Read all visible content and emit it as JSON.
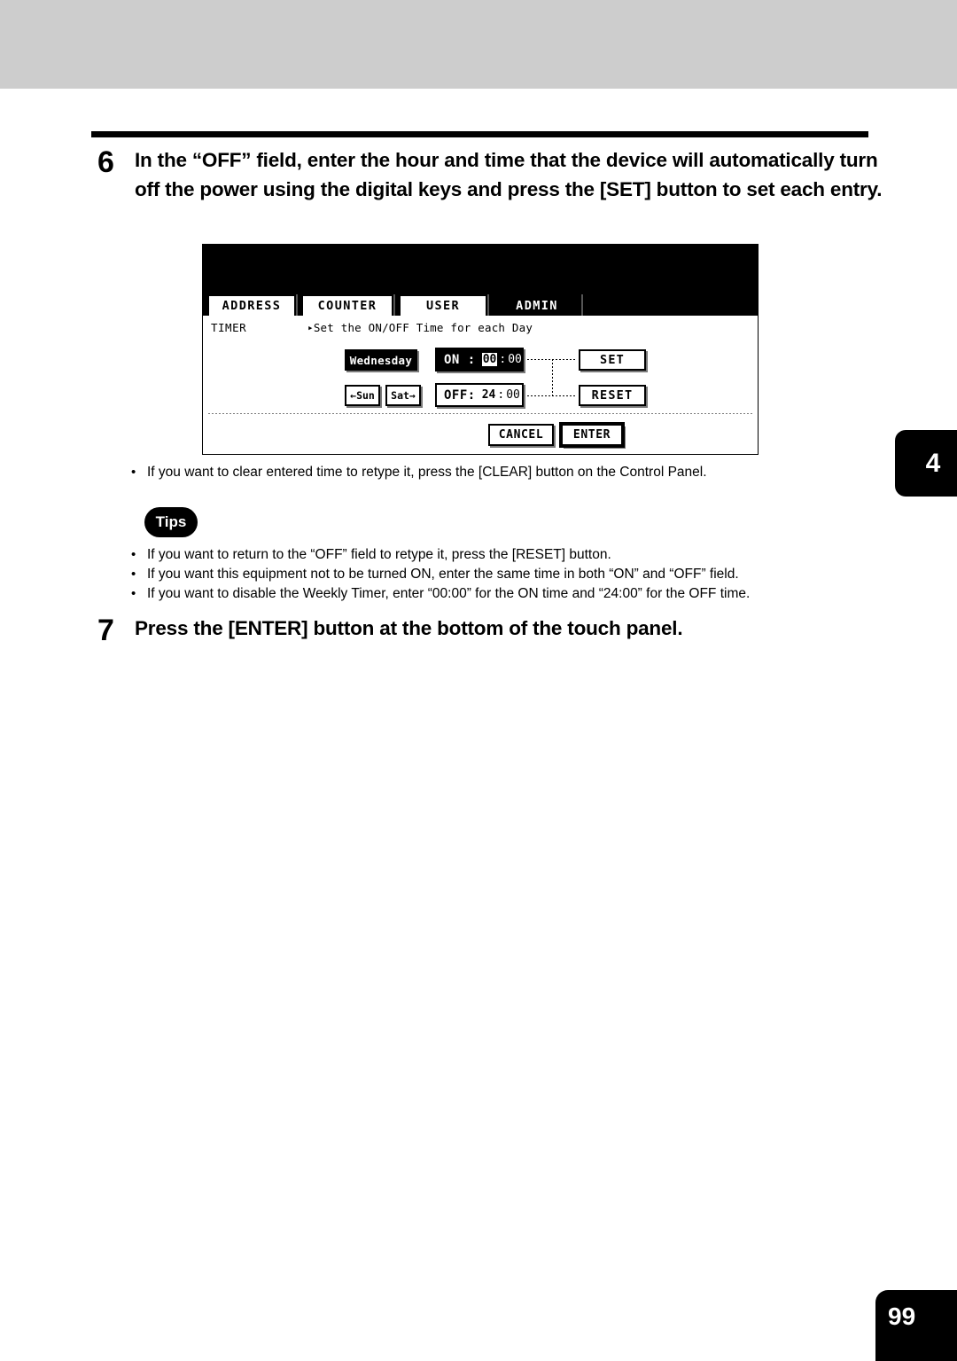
{
  "page": {
    "number": "99",
    "chapter_tab": "4"
  },
  "steps": [
    {
      "number": "6",
      "text": "In the “OFF” field, enter the hour and time that the device will automatically turn off the power using the digital keys and press the [SET] button to set each entry."
    },
    {
      "number": "7",
      "text": "Press the [ENTER] button at the bottom of the touch panel."
    }
  ],
  "notes": [
    {
      "bullet": "•",
      "text": "If you want to clear entered time to retype it, press the [CLEAR] button on the Control Panel."
    }
  ],
  "tips": {
    "badge": "Tips",
    "items": [
      {
        "bullet": "•",
        "text": "If you want to return to the “OFF” field to retype it, press the [RESET] button."
      },
      {
        "bullet": "•",
        "text": "If you want this equipment not to be turned ON, enter the same time in both “ON” and “OFF” field."
      },
      {
        "bullet": "•",
        "text": "If you want to disable the Weekly Timer, enter “00:00” for the ON time and “24:00” for the OFF time."
      }
    ]
  },
  "touch_panel": {
    "tabs": [
      {
        "label": "ADDRESS",
        "active": false
      },
      {
        "label": "COUNTER",
        "active": false
      },
      {
        "label": "USER",
        "active": false
      },
      {
        "label": "ADMIN",
        "active": true
      }
    ],
    "screen_label": "TIMER",
    "screen_description_arrow": "▸",
    "screen_description": "Set the ON/OFF Time for each Day",
    "weekday_button": "Wednesday",
    "prev_day_button": "←Sun",
    "next_day_button": "Sat→",
    "on_field": {
      "label": "ON :",
      "hour": "00",
      "separator": ":",
      "minute": "00"
    },
    "off_field": {
      "label": "OFF:",
      "hour": "24",
      "separator": ":",
      "minute": "00"
    },
    "set_button": "SET",
    "reset_button": "RESET",
    "cancel_button": "CANCEL",
    "enter_button": "ENTER"
  },
  "colors": {
    "top_band": "#cdcdcd",
    "ink": "#000000",
    "paper": "#ffffff",
    "key_shadow": "#7a7a7a"
  }
}
